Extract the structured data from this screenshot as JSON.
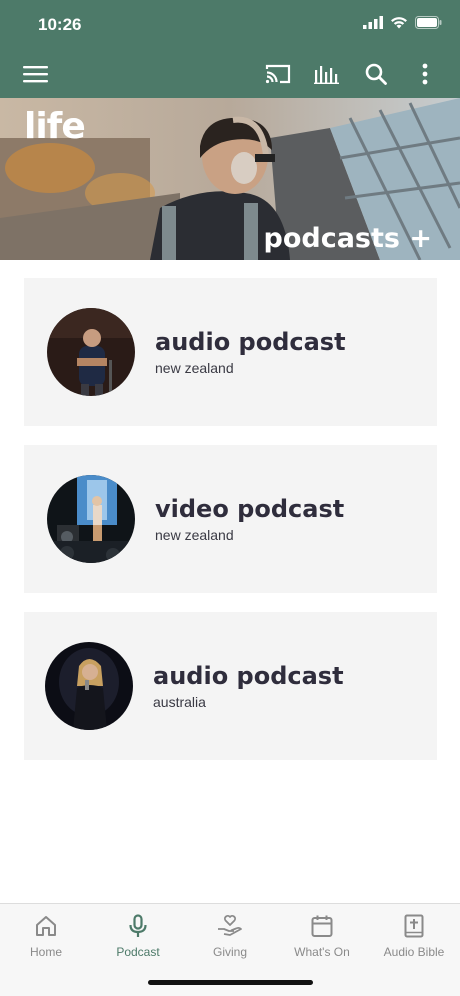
{
  "status": {
    "time": "10:26"
  },
  "hero": {
    "logo_text": "life",
    "title": "podcasts +"
  },
  "podcasts": [
    {
      "title": "audio podcast",
      "subtitle": "new zealand"
    },
    {
      "title": "video podcast",
      "subtitle": "new zealand"
    },
    {
      "title": "audio podcast",
      "subtitle": "australia"
    }
  ],
  "tabs": [
    {
      "label": "Home",
      "icon": "home-icon",
      "active": false
    },
    {
      "label": "Podcast",
      "icon": "microphone-icon",
      "active": true
    },
    {
      "label": "Giving",
      "icon": "giving-hand-heart-icon",
      "active": false
    },
    {
      "label": "What's On",
      "icon": "calendar-icon",
      "active": false
    },
    {
      "label": "Audio Bible",
      "icon": "bible-icon",
      "active": false
    }
  ],
  "colors": {
    "brand_green": "#4d7a69",
    "card_bg": "#f4f4f4",
    "title_text": "#2f2d3c"
  }
}
